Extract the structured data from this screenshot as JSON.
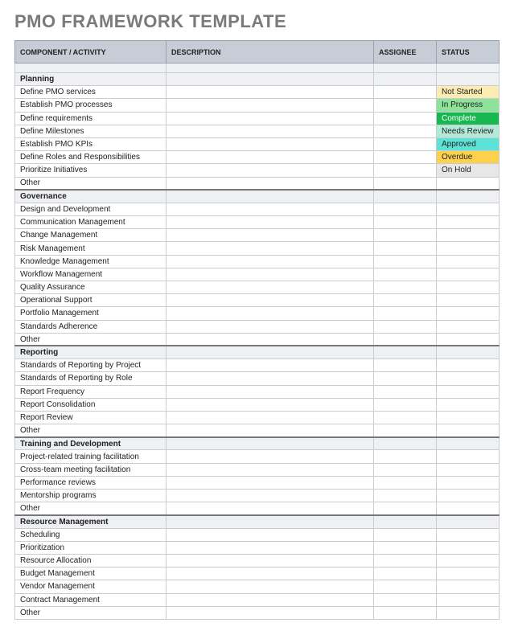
{
  "title": "PMO FRAMEWORK TEMPLATE",
  "columns": {
    "c1": "COMPONENT / ACTIVITY",
    "c2": "DESCRIPTION",
    "c3": "ASSIGNEE",
    "c4": "STATUS"
  },
  "status_labels": {
    "not_started": "Not Started",
    "in_progress": "In Progress",
    "complete": "Complete",
    "needs_review": "Needs Review",
    "approved": "Approved",
    "overdue": "Overdue",
    "on_hold": "On Hold"
  },
  "sections": [
    {
      "name": "Planning",
      "items": [
        "Define PMO services",
        "Establish PMO processes",
        "Define requirements",
        "Define Milestones",
        "Establish PMO KPIs",
        "Define Roles and Responsibilities",
        "Prioritize Initiatives",
        "Other"
      ]
    },
    {
      "name": "Governance",
      "items": [
        "Design and Development",
        "Communication Management",
        "Change Management",
        "Risk Management",
        "Knowledge Management",
        "Workflow Management",
        "Quality Assurance",
        "Operational Support",
        "Portfolio Management",
        "Standards Adherence",
        "Other"
      ]
    },
    {
      "name": "Reporting",
      "items": [
        "Standards of Reporting by Project",
        "Standards of Reporting by Role",
        "Report Frequency",
        "Report Consolidation",
        "Report Review",
        "Other"
      ]
    },
    {
      "name": "Training and Development",
      "items": [
        "Project-related training facilitation",
        "Cross-team meeting facilitation",
        "Performance reviews",
        "Mentorship programs",
        "Other"
      ]
    },
    {
      "name": "Resource Management",
      "items": [
        "Scheduling",
        "Prioritization",
        "Resource Allocation",
        "Budget Management",
        "Vendor Management",
        "Contract Management",
        "Other"
      ]
    }
  ]
}
